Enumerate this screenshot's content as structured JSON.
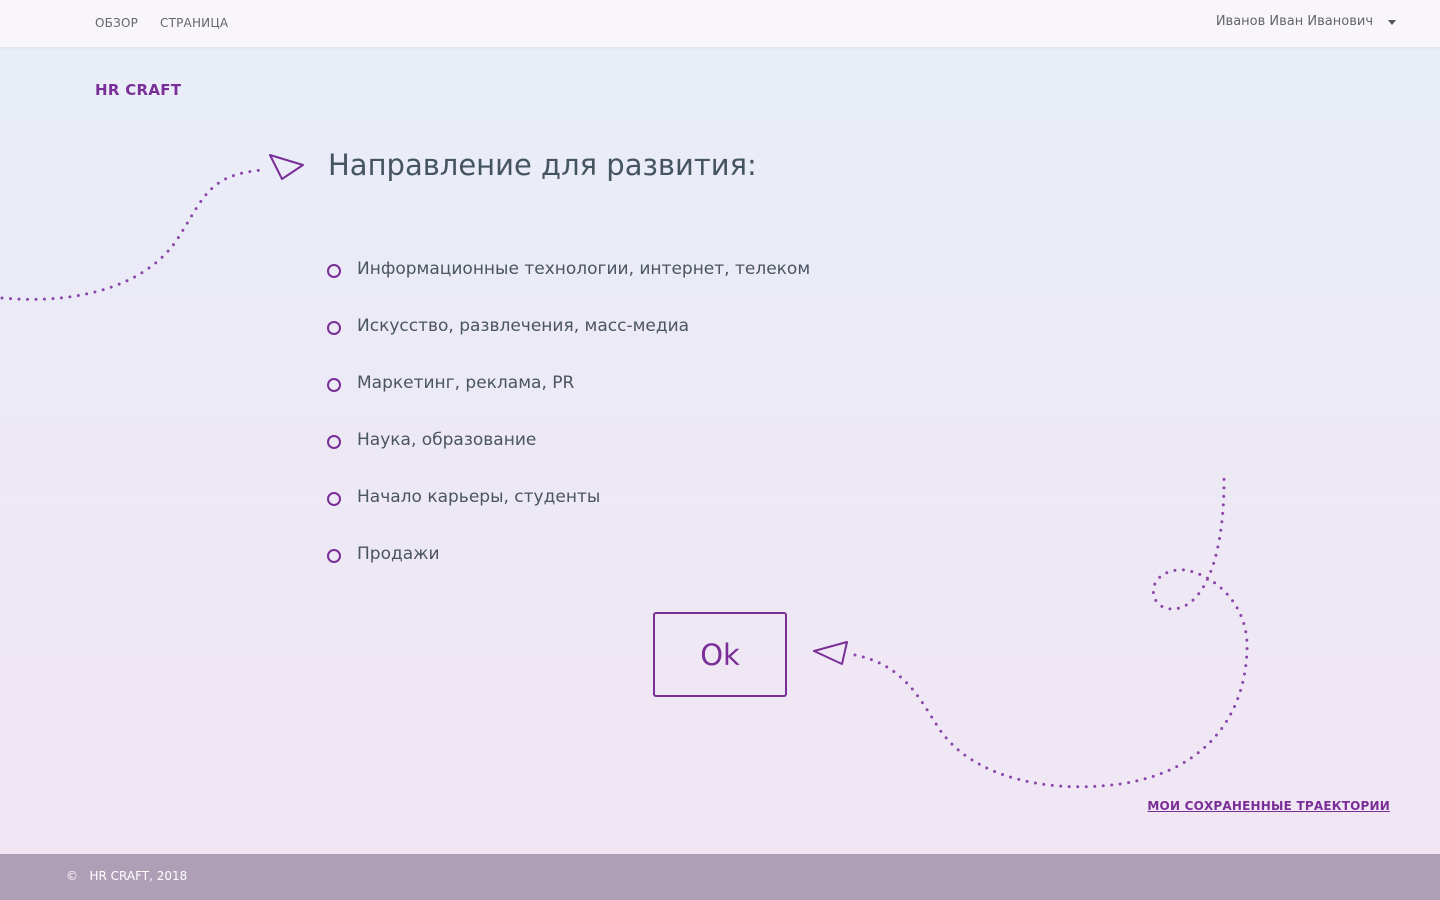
{
  "nav": {
    "links": [
      "ОБЗОР",
      "СТРАНИЦА"
    ],
    "user_name": "Иванов Иван Иванович"
  },
  "brand": "HR CRAFT",
  "heading": "Направление для развития:",
  "options": [
    "Информационные технологии, интернет, телеком",
    "Искусство, развлечения, масс-медиа",
    "Маркетинг, реклама, PR",
    "Наука, образование",
    "Начало карьеры, студенты",
    "Продажи"
  ],
  "ok_label": "Ok",
  "saved_link": "МОИ СОХРАНЕННЫЕ ТРАЕКТОРИИ",
  "footer": {
    "copyright_symbol": "©",
    "text": "HR CRAFT, 2018"
  },
  "colors": {
    "accent": "#7a2e97",
    "footer_bg": "#af9fb6",
    "text": "#4a5560"
  },
  "icons": [
    "paper-plane-icon",
    "caret-down-icon",
    "radio-icon"
  ]
}
